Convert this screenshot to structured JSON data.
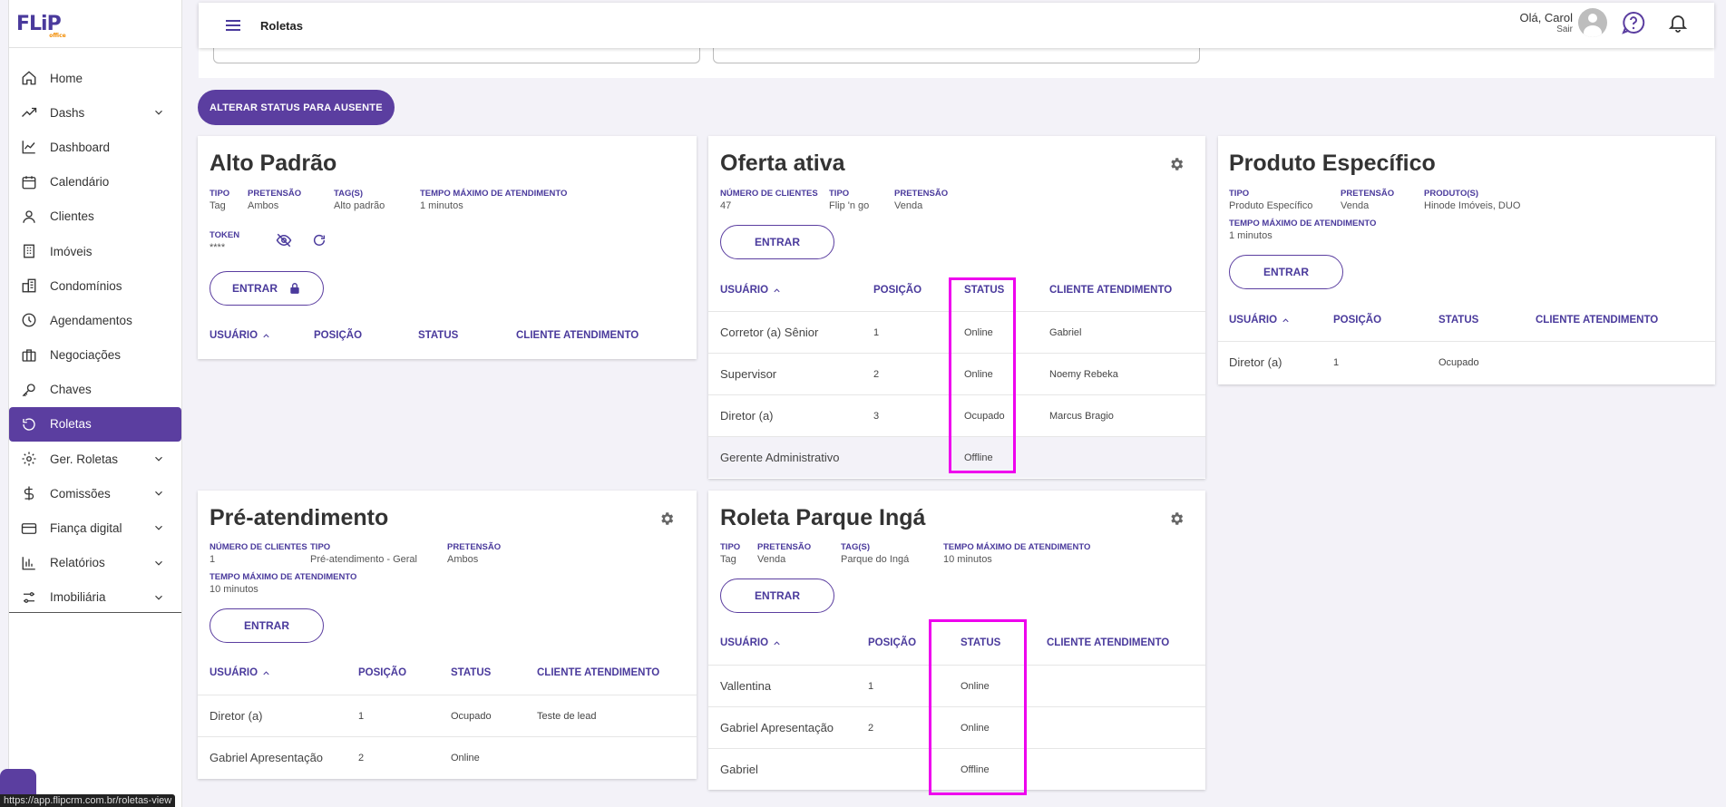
{
  "app": {
    "logo": "FLiP",
    "logo_sub": "office"
  },
  "sidebar": {
    "items": [
      {
        "label": "Home",
        "icon": "home-icon"
      },
      {
        "label": "Dashs",
        "icon": "trending-icon"
      },
      {
        "label": "Dashboard",
        "icon": "line-chart-icon"
      },
      {
        "label": "Calendário",
        "icon": "calendar-icon"
      },
      {
        "label": "Clientes",
        "icon": "user-icon"
      },
      {
        "label": "Imóveis",
        "icon": "building-icon"
      },
      {
        "label": "Condomínios",
        "icon": "city-icon"
      },
      {
        "label": "Agendamentos",
        "icon": "clock-icon"
      },
      {
        "label": "Negociações",
        "icon": "briefcase-icon"
      },
      {
        "label": "Chaves",
        "icon": "key-icon"
      },
      {
        "label": "Roletas",
        "icon": "roulette-icon"
      },
      {
        "label": "Ger. Roletas",
        "icon": "settings-icon"
      },
      {
        "label": "Comissões",
        "icon": "dollar-icon"
      },
      {
        "label": "Fiança digital",
        "icon": "card-icon"
      },
      {
        "label": "Relatórios",
        "icon": "bar-chart-icon"
      },
      {
        "label": "Imobiliária",
        "icon": "sliders-icon"
      }
    ],
    "url_tip": "https://app.flipcrm.com.br/roletas-view"
  },
  "topbar": {
    "title": "Roletas",
    "greeting": "Olá, Carol",
    "logout": "Sair"
  },
  "actions": {
    "set_absent": "ALTERAR STATUS PARA AUSENTE"
  },
  "cards": {
    "alto": {
      "title": "Alto Padrão",
      "meta": [
        {
          "label": "TIPO",
          "value": "Tag"
        },
        {
          "label": "PRETENSÃO",
          "value": "Ambos"
        },
        {
          "label": "TAG(S)",
          "value": "Alto padrão"
        },
        {
          "label": "TEMPO MÁXIMO DE ATENDIMENTO",
          "value": "1 minutos"
        }
      ],
      "token_label": "TOKEN",
      "token_value": "****",
      "enter": "ENTRAR",
      "headers": [
        "USUÁRIO",
        "POSIÇÃO",
        "STATUS",
        "CLIENTE ATENDIMENTO"
      ]
    },
    "oferta": {
      "title": "Oferta ativa",
      "meta": [
        {
          "label": "NÚMERO DE CLIENTES",
          "value": "47"
        },
        {
          "label": "TIPO",
          "value": "Flip 'n go"
        },
        {
          "label": "PRETENSÃO",
          "value": "Venda"
        }
      ],
      "enter": "ENTRAR",
      "headers": [
        "USUÁRIO",
        "POSIÇÃO",
        "STATUS",
        "CLIENTE ATENDIMENTO"
      ],
      "rows": [
        [
          "Corretor (a) Sênior",
          "1",
          "Online",
          "Gabriel"
        ],
        [
          "Supervisor",
          "2",
          "Online",
          "Noemy Rebeka"
        ],
        [
          "Diretor (a)",
          "3",
          "Ocupado",
          "Marcus Bragio"
        ],
        [
          "Gerente Administrativo",
          "",
          "Offline",
          ""
        ]
      ]
    },
    "produto": {
      "title": "Produto Específico",
      "meta": [
        {
          "label": "TIPO",
          "value": "Produto Específico"
        },
        {
          "label": "PRETENSÃO",
          "value": "Venda"
        },
        {
          "label": "PRODUTO(S)",
          "value": "Hinode Imóveis, DUO"
        },
        {
          "label": "TEMPO MÁXIMO DE ATENDIMENTO",
          "value": "1 minutos"
        }
      ],
      "enter": "ENTRAR",
      "headers": [
        "USUÁRIO",
        "POSIÇÃO",
        "STATUS",
        "CLIENTE ATENDIMENTO"
      ],
      "rows": [
        [
          "Diretor (a)",
          "1",
          "Ocupado",
          ""
        ]
      ]
    },
    "pre": {
      "title": "Pré-atendimento",
      "meta": [
        {
          "label": "NÚMERO DE CLIENTES",
          "value": "1"
        },
        {
          "label": "TIPO",
          "value": "Pré-atendimento - Geral"
        },
        {
          "label": "PRETENSÃO",
          "value": "Ambos"
        },
        {
          "label": "TEMPO MÁXIMO DE ATENDIMENTO",
          "value": "10 minutos"
        }
      ],
      "enter": "ENTRAR",
      "headers": [
        "USUÁRIO",
        "POSIÇÃO",
        "STATUS",
        "CLIENTE ATENDIMENTO"
      ],
      "rows": [
        [
          "Diretor (a)",
          "1",
          "Ocupado",
          "Teste de lead"
        ],
        [
          "Gabriel Apresentação",
          "2",
          "Online",
          ""
        ]
      ]
    },
    "parque": {
      "title": "Roleta Parque Ingá",
      "meta": [
        {
          "label": "TIPO",
          "value": "Tag"
        },
        {
          "label": "PRETENSÃO",
          "value": "Venda"
        },
        {
          "label": "TAG(S)",
          "value": "Parque do Ingá"
        },
        {
          "label": "TEMPO MÁXIMO DE ATENDIMENTO",
          "value": "10 minutos"
        }
      ],
      "enter": "ENTRAR",
      "headers": [
        "USUÁRIO",
        "POSIÇÃO",
        "STATUS",
        "CLIENTE ATENDIMENTO"
      ],
      "rows": [
        [
          "Vallentina",
          "1",
          "Online",
          ""
        ],
        [
          "Gabriel Apresentação",
          "2",
          "Online",
          ""
        ],
        [
          "Gabriel",
          "",
          "Offline",
          ""
        ]
      ]
    }
  },
  "colors": {
    "brand": "#5b3ea0",
    "highlight": "#ee00ee",
    "background": "#f3f2f8"
  }
}
